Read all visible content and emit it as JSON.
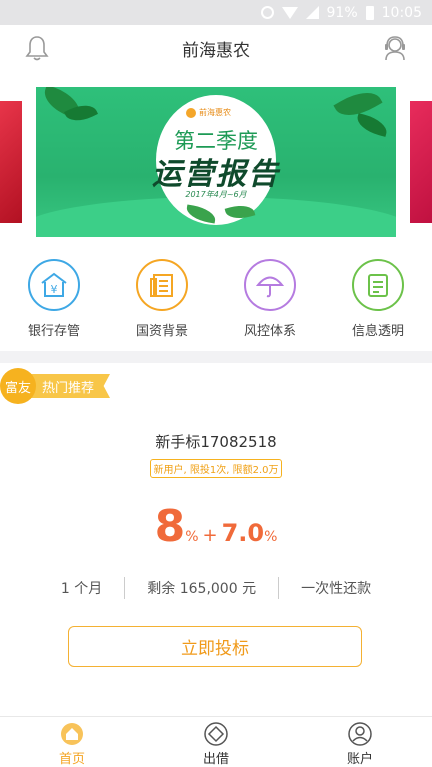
{
  "status_bar": {
    "battery": "91%",
    "time": "10:05"
  },
  "header": {
    "title": "前海惠农"
  },
  "banner": {
    "brand": "前海惠农",
    "line1": "第二季度",
    "line2": "运营报告",
    "date_range": "2017年4月~6月"
  },
  "features": [
    {
      "label": "银行存管",
      "icon": "bank-icon",
      "color": "#3ea8e5"
    },
    {
      "label": "国资背景",
      "icon": "document-icon",
      "color": "#f5a623"
    },
    {
      "label": "风控体系",
      "icon": "umbrella-icon",
      "color": "#b57be0"
    },
    {
      "label": "信息透明",
      "icon": "clipboard-icon",
      "color": "#6cc24a"
    }
  ],
  "product": {
    "tag_circle": "富友",
    "tag_label": "热门推荐",
    "name": "新手标17082518",
    "limits": "新用户, 限投1次, 限额2.0万",
    "rate_base": "8",
    "rate_base_unit": "%",
    "rate_plus": "+",
    "rate_extra": "7.0",
    "rate_extra_unit": "%",
    "term": "1 个月",
    "remaining": "剩余 165,000 元",
    "repayment": "一次性还款",
    "invest_button": "立即投标"
  },
  "bottom_nav": [
    {
      "label": "首页",
      "icon": "home-icon",
      "active": true
    },
    {
      "label": "出借",
      "icon": "diamond-icon",
      "active": false
    },
    {
      "label": "账户",
      "icon": "user-icon",
      "active": false
    }
  ],
  "colors": {
    "accent": "#f4a524",
    "rate": "#f06a3a",
    "banner_green": "#2ec07a"
  }
}
